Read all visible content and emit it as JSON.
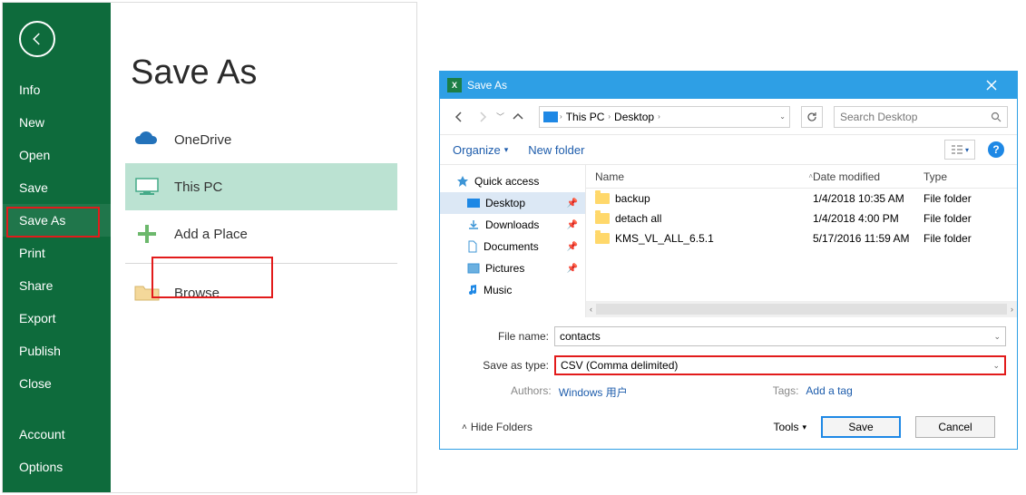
{
  "backstage": {
    "title": "Save As",
    "sidebar": [
      "Info",
      "New",
      "Open",
      "Save",
      "Save As",
      "Print",
      "Share",
      "Export",
      "Publish",
      "Close",
      "Account",
      "Options"
    ],
    "selected_sidebar": "Save As",
    "locations": {
      "onedrive": "OneDrive",
      "thispc": "This PC",
      "addplace": "Add a Place",
      "browse": "Browse"
    },
    "selected_location": "This PC"
  },
  "dialog": {
    "title": "Save As",
    "breadcrumb": [
      "This PC",
      "Desktop"
    ],
    "search_placeholder": "Search Desktop",
    "toolbar": {
      "organize": "Organize",
      "newfolder": "New folder"
    },
    "tree": {
      "quick_access": "Quick access",
      "items": [
        "Desktop",
        "Downloads",
        "Documents",
        "Pictures",
        "Music"
      ],
      "selected": "Desktop"
    },
    "columns": [
      "Name",
      "Date modified",
      "Type"
    ],
    "rows": [
      {
        "name": "backup",
        "date": "1/4/2018 10:35 AM",
        "type": "File folder"
      },
      {
        "name": "detach all",
        "date": "1/4/2018 4:00 PM",
        "type": "File folder"
      },
      {
        "name": "KMS_VL_ALL_6.5.1",
        "date": "5/17/2016 11:59 AM",
        "type": "File folder"
      }
    ],
    "filename_label": "File name:",
    "filename_value": "contacts",
    "saveas_label": "Save as type:",
    "saveas_value": "CSV (Comma delimited)",
    "authors_label": "Authors:",
    "authors_value": "Windows 用户",
    "tags_label": "Tags:",
    "tags_value": "Add a tag",
    "hide_folders": "Hide Folders",
    "tools": "Tools",
    "save": "Save",
    "cancel": "Cancel"
  }
}
